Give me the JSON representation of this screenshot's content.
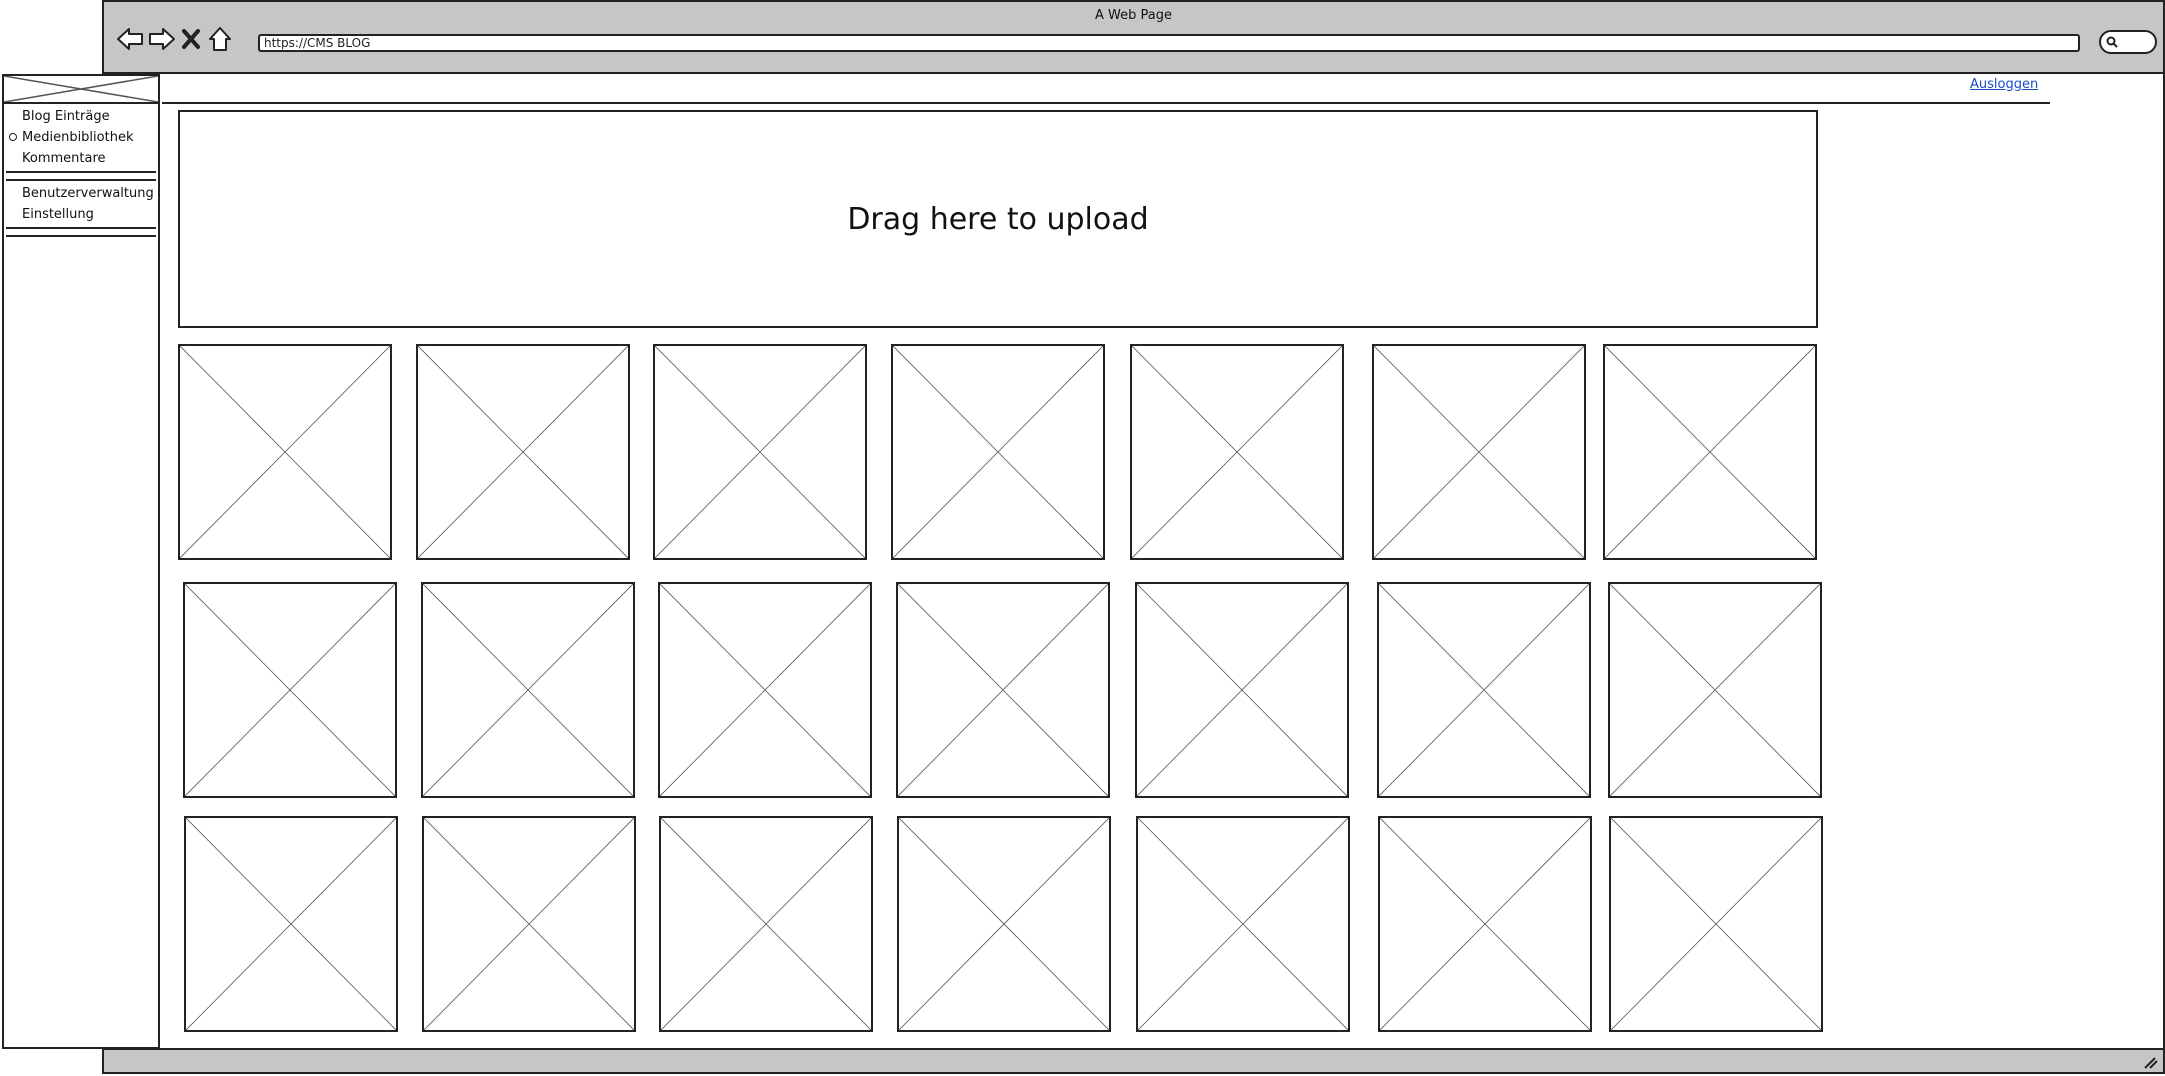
{
  "browser": {
    "title": "A Web Page",
    "url": "https://CMS BLOG"
  },
  "header": {
    "logout_label": "Ausloggen"
  },
  "sidebar": {
    "items": [
      {
        "label": "Blog Einträge",
        "selected": false
      },
      {
        "label": "Medienbibliothek",
        "selected": true
      },
      {
        "label": "Kommentare",
        "selected": false
      },
      {
        "label": "Benutzerverwaltung",
        "selected": false
      },
      {
        "label": "Einstellung",
        "selected": false
      }
    ]
  },
  "upload": {
    "label": "Drag here to upload"
  },
  "gallery": {
    "rows": 3,
    "columns": 7,
    "item_type": "image-placeholder"
  },
  "colors": {
    "chrome": "#c6c6c6",
    "link": "#1a4dc4"
  }
}
